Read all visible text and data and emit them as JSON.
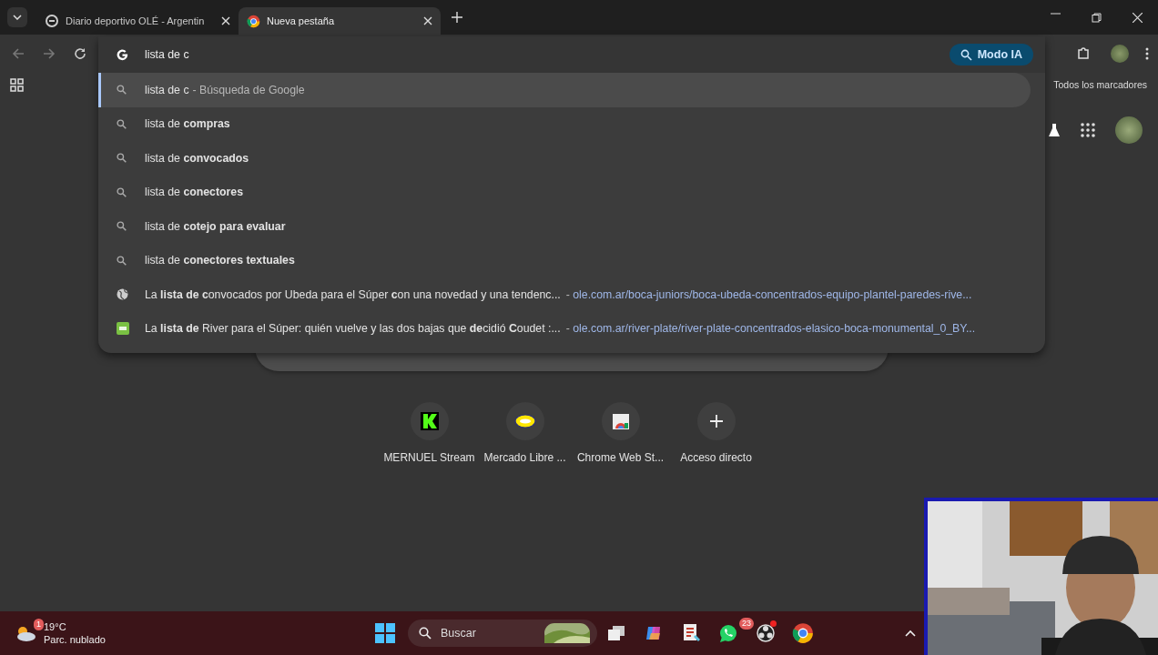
{
  "tabs": [
    {
      "title": "Diario deportivo OLÉ - Argentin",
      "kind": "site",
      "selected": false
    },
    {
      "title": "Nueva pestaña",
      "kind": "newtab",
      "selected": true
    }
  ],
  "omnibox": {
    "value": "lista de c",
    "ai_button": "Modo IA"
  },
  "bookmarks_bar": {
    "all_bookmarks": "Todos los marcadores"
  },
  "suggestions": [
    {
      "kind": "search",
      "text": "lista de c",
      "suffix": "- Búsqueda de Google",
      "selected": true
    },
    {
      "kind": "search",
      "text": "lista de **compras**",
      "selected": false
    },
    {
      "kind": "search",
      "text": "lista de **convocados**",
      "selected": false
    },
    {
      "kind": "search",
      "text": "lista de **conectores**",
      "selected": false
    },
    {
      "kind": "search",
      "text": "lista de **cotejo para evaluar**",
      "selected": false
    },
    {
      "kind": "search",
      "text": "lista de **conectores textuales**",
      "selected": false
    },
    {
      "kind": "page",
      "text": "La **lista de c**onvocados por Ubeda para el Súper **c**on una novedad y una tendenc...",
      "separator": "-",
      "url": "ole.com.ar/boca-juniors/boca-ubeda-concentrados-equipo-plantel-paredes-rive...",
      "selected": false
    },
    {
      "kind": "site",
      "text": "La **lista de** River para el Súper: quién vuelve y las dos bajas que **de**cidió **C**oudet :...",
      "separator": "-",
      "url": "ole.com.ar/river-plate/river-plate-concentrados-elasico-boca-monumental_0_BY...",
      "selected": false
    }
  ],
  "shortcuts": [
    {
      "kind": "k",
      "label": "MERNUEL Stream"
    },
    {
      "kind": "market",
      "label": "Mercado Libre ..."
    },
    {
      "kind": "store",
      "label": "Chrome Web St..."
    },
    {
      "kind": "add",
      "label": "Acceso directo"
    }
  ],
  "taskbar": {
    "weather": {
      "badge": "1",
      "temperature": "19°C",
      "condition": "Parc. nublado"
    },
    "search": {
      "placeholder": "Buscar"
    },
    "apps": [
      {
        "kind": "taskview"
      },
      {
        "kind": "copilot"
      },
      {
        "kind": "notes"
      },
      {
        "kind": "whatsapp",
        "badge": "23"
      },
      {
        "kind": "obs"
      },
      {
        "kind": "chrome"
      }
    ]
  }
}
